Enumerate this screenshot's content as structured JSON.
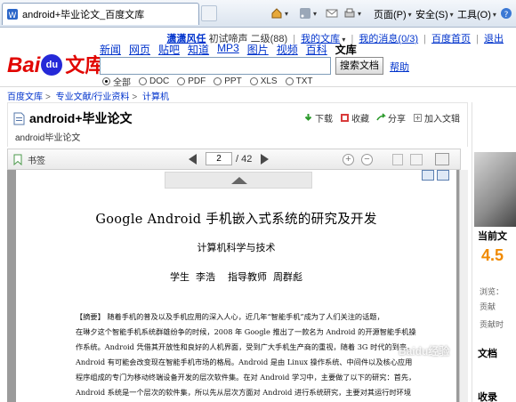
{
  "browser": {
    "tab_title": "android+毕业论文_百度文库",
    "commands": [
      "页面(P)",
      "安全(S)",
      "工具(O)"
    ]
  },
  "toplinks": {
    "user": "潇潇风任",
    "level": "初试啼声 二级(88)",
    "mydoc": "我的文库",
    "messages": "我的消息(0/3)",
    "home": "百度首页",
    "logout": "退出"
  },
  "logo": {
    "bai": "Bai",
    "du": "du",
    "wenku": "文库"
  },
  "nav": [
    "新闻",
    "网页",
    "贴吧",
    "知道",
    "MP3",
    "图片",
    "视频",
    "百科",
    "文库"
  ],
  "search": {
    "button": "搜索文档",
    "help": "帮助",
    "value": ""
  },
  "filters": [
    {
      "label": "全部",
      "checked": true
    },
    {
      "label": "DOC",
      "checked": false
    },
    {
      "label": "PDF",
      "checked": false
    },
    {
      "label": "PPT",
      "checked": false
    },
    {
      "label": "XLS",
      "checked": false
    },
    {
      "label": "TXT",
      "checked": false
    }
  ],
  "breadcrumb": [
    "百度文库",
    "专业文献/行业资料",
    "计算机"
  ],
  "doc": {
    "title": "android+毕业论文",
    "subtitle": "android毕业论文",
    "tools": [
      "下载",
      "收藏",
      "分享",
      "加入文辑"
    ]
  },
  "reader": {
    "bookmark": "书签",
    "current_page": "2",
    "total_pages": "/ 42"
  },
  "page": {
    "title": "Google Android 手机嵌入式系统的研究及开发",
    "subtitle": "计算机科学与技术",
    "authors": "学生  李浩    指导教师  周群彪",
    "abstract": [
      "【摘要】 随着手机的普及以及手机应用的深入人心，近几年“智能手机”成为了人们关注的话题，",
      "在琳夕这个智能手机系统群雄纷争的时候，2008 年 Google 推出了一款名为 Android 的开源智能手机操",
      "作系统。Android 凭借其开放性和良好的人机界面，受到广大手机生产商的重视，随着 3G 时代的到来，",
      "Android 有可能会改变现在智能手机市场的格局。Android 是由 Linux 操作系统、中间件以及核心应用",
      "程序组成的专门为移动终端设备开发的层次软件集。在对 Android 学习中，主要做了以下的研究：首先，",
      "Android 系统是一个层次的软件集，所以先从层次方面对 Android 进行系统研究，主要对其运行时环境"
    ]
  },
  "sidebar": {
    "current_doc": "当前文",
    "rating": "4.5",
    "views": "浏览：",
    "contrib": "贡献",
    "contrib_time": "贡献时",
    "doc_label": "文档",
    "collect": "收录"
  },
  "watermark": "Baidu经验"
}
